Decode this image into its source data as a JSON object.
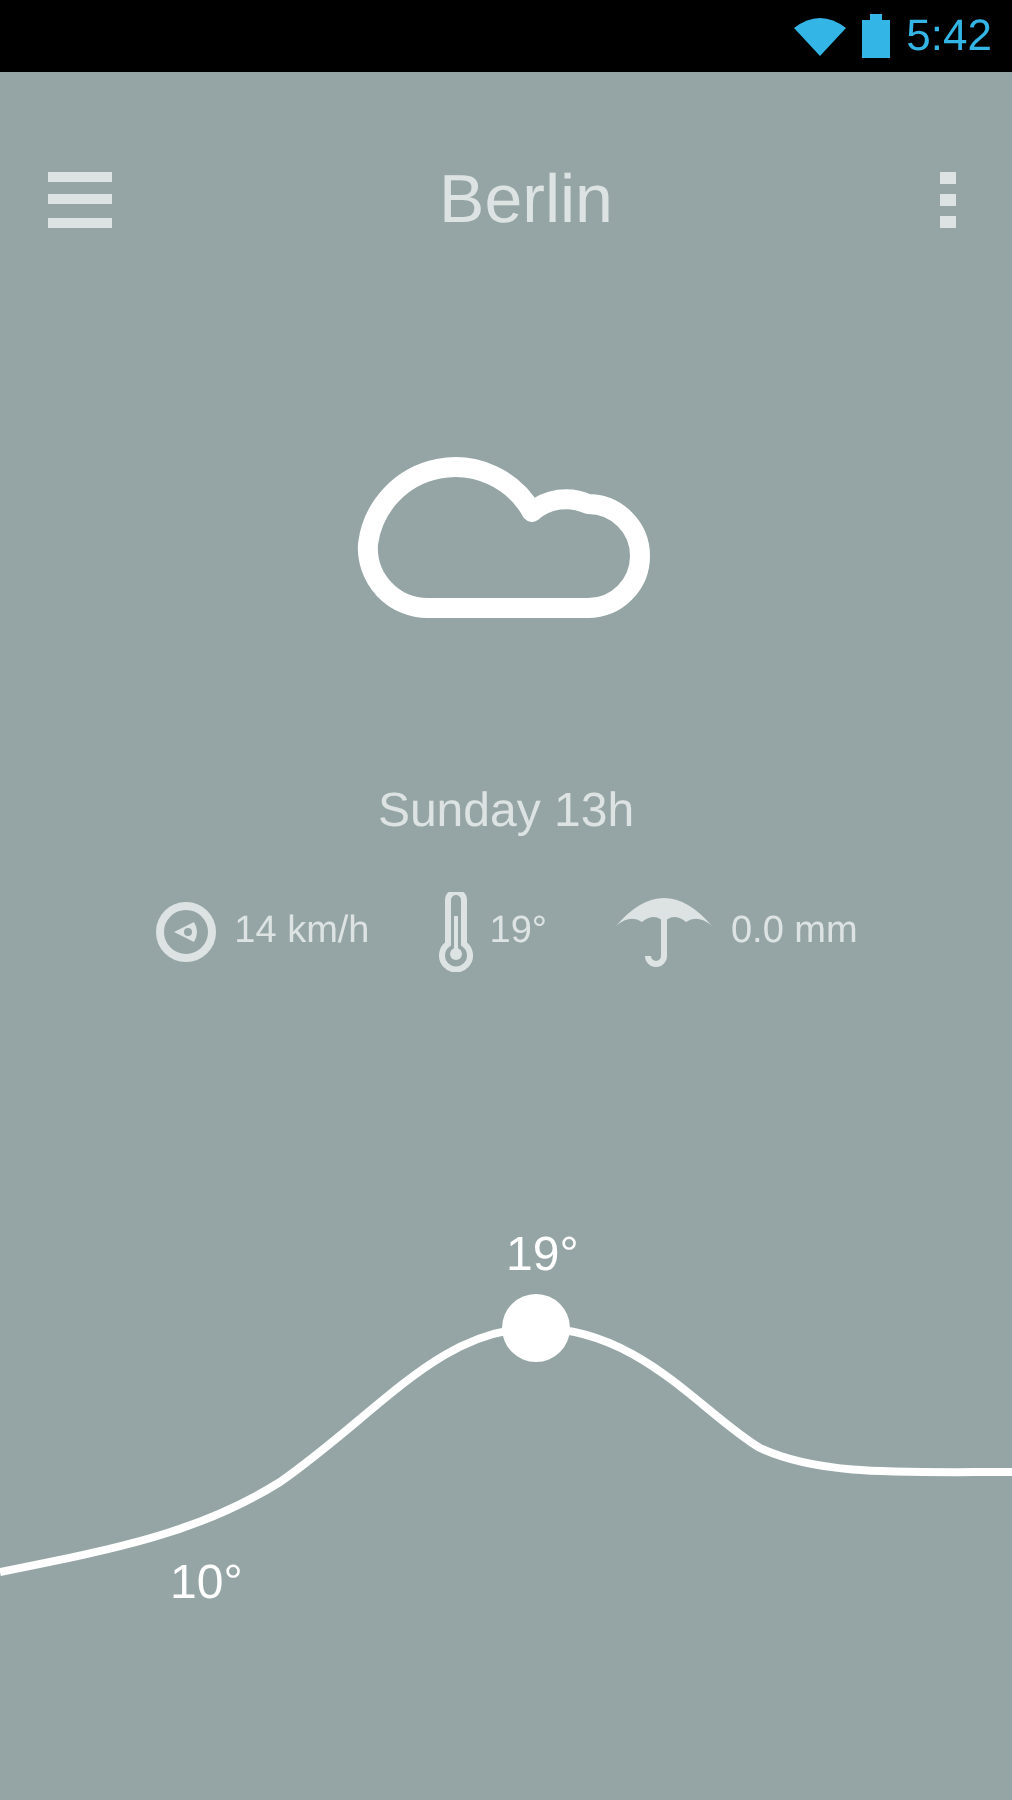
{
  "status_bar": {
    "time": "5:42"
  },
  "header": {
    "title": "Berlin"
  },
  "forecast": {
    "time_label": "Sunday 13h"
  },
  "details": [
    {
      "kind": "wind",
      "value": "14 km/h"
    },
    {
      "kind": "temperature",
      "value": "19°"
    },
    {
      "kind": "rain",
      "value": "0.0 mm"
    }
  ],
  "graph": {
    "high_label": "19°",
    "low_label": "10°"
  }
}
